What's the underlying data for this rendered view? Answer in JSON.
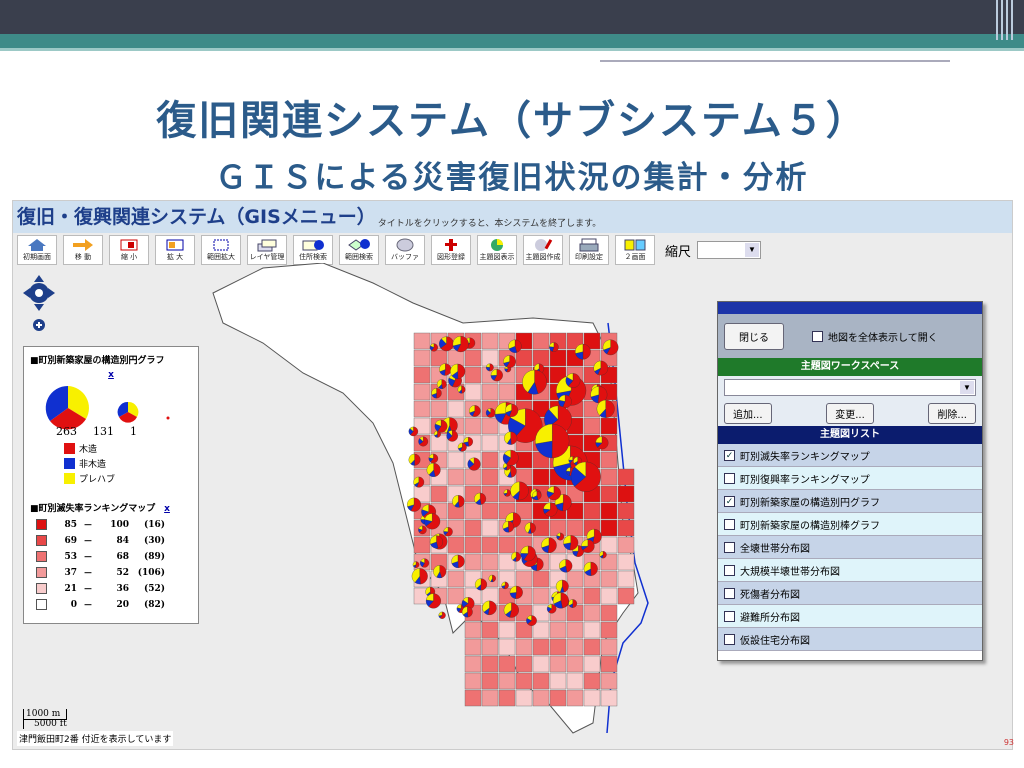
{
  "slide": {
    "title": "復旧関連システム（サブシステム５）",
    "subtitle": "ＧＩＳによる災害復旧状況の集計・分析",
    "page_number": "93"
  },
  "app": {
    "title": "復旧・復興関連システム（GISメニュー）",
    "title_hint": "タイトルをクリックすると、本システムを終了します。"
  },
  "toolbar": {
    "buttons": [
      {
        "label": "初期画面",
        "icon": "home-icon"
      },
      {
        "label": "移 動",
        "icon": "arrow-right-icon"
      },
      {
        "label": "縮 小",
        "icon": "zoom-out-icon"
      },
      {
        "label": "拡 大",
        "icon": "zoom-in-icon"
      },
      {
        "label": "範囲拡大",
        "icon": "range-zoom-icon"
      },
      {
        "label": "レイヤ管理",
        "icon": "layers-icon"
      },
      {
        "label": "住所検索",
        "icon": "address-search-icon"
      },
      {
        "label": "範囲検索",
        "icon": "range-search-icon"
      },
      {
        "label": "バッファ",
        "icon": "buffer-icon"
      },
      {
        "label": "図形登録",
        "icon": "shape-register-icon"
      },
      {
        "label": "主題図表示",
        "icon": "theme-map-icon"
      },
      {
        "label": "主題図作成",
        "icon": "theme-create-icon"
      },
      {
        "label": "印刷設定",
        "icon": "printer-icon"
      },
      {
        "label": "２画面",
        "icon": "split-screen-icon"
      }
    ],
    "scale_label": "縮尺",
    "scale_value": ""
  },
  "legend": {
    "pie_title": "■町別新築家屋の構造別円グラフ",
    "close": "x",
    "pie_sizes": [
      "263",
      "131",
      "1"
    ],
    "categories": [
      {
        "label": "木造",
        "color": "#e01010"
      },
      {
        "label": "非木造",
        "color": "#1030d0"
      },
      {
        "label": "プレハブ",
        "color": "#f8f000"
      }
    ],
    "ranking_title": "■町別滅失率ランキングマップ",
    "ranking_close": "x",
    "ranges": [
      {
        "min": "85",
        "max": "100",
        "count": "(16)",
        "color": "#dd1111"
      },
      {
        "min": "69",
        "max": "84",
        "count": "(30)",
        "color": "#e84848"
      },
      {
        "min": "53",
        "max": "68",
        "count": "(89)",
        "color": "#ee7272"
      },
      {
        "min": "37",
        "max": "52",
        "count": "(106)",
        "color": "#f29a9a"
      },
      {
        "min": "21",
        "max": "36",
        "count": "(52)",
        "color": "#f8cccc"
      },
      {
        "min": "0",
        "max": "20",
        "count": "(82)",
        "color": "#ffffff"
      }
    ],
    "dash": "－"
  },
  "panel": {
    "close_button": "閉じる",
    "fullscreen_checkbox": "地図を全体表示して開く",
    "workspace_header": "主題図ワークスペース",
    "workspace_value": "",
    "add_button": "追加...",
    "change_button": "変更...",
    "delete_button": "削除...",
    "list_header": "主題図リスト",
    "list": [
      {
        "label": "町別滅失率ランキングマップ",
        "checked": true
      },
      {
        "label": "町別復興率ランキングマップ",
        "checked": false
      },
      {
        "label": "町別新築家屋の構造別円グラフ",
        "checked": true
      },
      {
        "label": "町別新築家屋の構造別棒グラフ",
        "checked": false
      },
      {
        "label": "全壊世帯分布図",
        "checked": false
      },
      {
        "label": "大規模半壊世帯分布図",
        "checked": false
      },
      {
        "label": "死傷者分布図",
        "checked": false
      },
      {
        "label": "避難所分布図",
        "checked": false
      },
      {
        "label": "仮設住宅分布図",
        "checked": false
      }
    ]
  },
  "map": {
    "scale_bar_top": "1000 m",
    "scale_bar_bottom": "5000 ft",
    "status": "津門飯田町2番 付近を表示しています"
  }
}
